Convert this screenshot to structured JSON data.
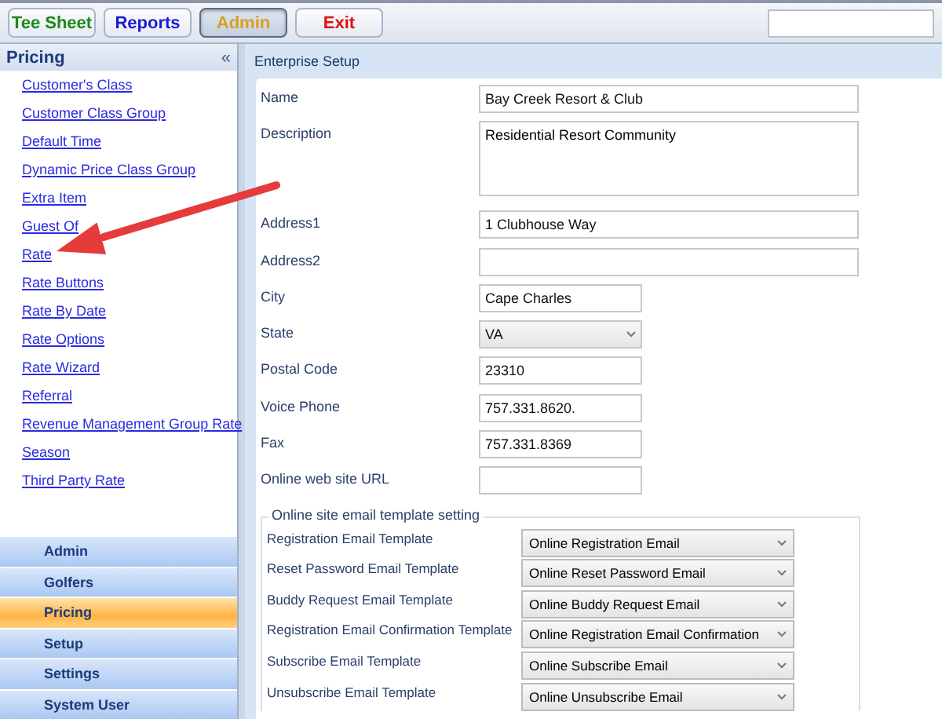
{
  "toolbar": {
    "buttons": [
      {
        "label": "Tee Sheet",
        "color": "#1a8a1a",
        "selected": false
      },
      {
        "label": "Reports",
        "color": "#1a1ad0",
        "selected": false
      },
      {
        "label": "Admin",
        "color": "#d8a020",
        "selected": true
      },
      {
        "label": "Exit",
        "color": "#e01010",
        "selected": false
      }
    ]
  },
  "sidebar": {
    "title": "Pricing",
    "collapse": "«",
    "links": [
      "Customer's Class",
      "Customer Class Group",
      "Default Time",
      "Dynamic Price Class Group",
      "Extra Item",
      "Guest Of",
      "Rate",
      "Rate Buttons",
      "Rate By Date",
      "Rate Options",
      "Rate Wizard",
      "Referral",
      "Revenue Management Group Rate",
      "Season",
      "Third Party Rate"
    ],
    "sections": [
      {
        "label": "Admin",
        "selected": false
      },
      {
        "label": "Golfers",
        "selected": false
      },
      {
        "label": "Pricing",
        "selected": true
      },
      {
        "label": "Setup",
        "selected": false
      },
      {
        "label": "Settings",
        "selected": false
      },
      {
        "label": "System User",
        "selected": false
      }
    ]
  },
  "annotation": {
    "kind": "arrow"
  },
  "panel": {
    "title": "Enterprise Setup",
    "fields": [
      {
        "label": "Name",
        "value": "Bay Creek Resort & Club",
        "kind": "wide"
      },
      {
        "label": "Description",
        "value": "Residential Resort Community",
        "kind": "textarea"
      },
      {
        "label": "Address1",
        "value": "1 Clubhouse Way",
        "kind": "wide"
      },
      {
        "label": "Address2",
        "kind": "wide"
      },
      {
        "label": "City",
        "value": "Cape Charles",
        "kind": "short"
      },
      {
        "label": "State",
        "value": "VA",
        "kind": "select"
      },
      {
        "label": "Postal Code",
        "value": "23310",
        "kind": "short"
      },
      {
        "label": "Voice Phone",
        "value": "757.331.8620.",
        "kind": "short"
      },
      {
        "label": "Fax",
        "value": "757.331.8369",
        "kind": "short"
      },
      {
        "label": "Online web site URL",
        "kind": "short"
      }
    ],
    "email_group": {
      "legend": "Online site email template setting",
      "rows": [
        {
          "label": "Registration Email Template",
          "value": "Online Registration Email"
        },
        {
          "label": "Reset Password Email Template",
          "value": "Online Reset Password Email"
        },
        {
          "label": "Buddy Request Email Template",
          "value": "Online Buddy Request Email"
        },
        {
          "label": "Registration Email Confirmation Template",
          "value": "Online Registration Email Confirmation"
        },
        {
          "label": "Subscribe Email Template",
          "value": "Online Subscribe Email"
        },
        {
          "label": "Unsubscribe Email Template",
          "value": "Online Unsubscribe Email"
        }
      ]
    }
  }
}
